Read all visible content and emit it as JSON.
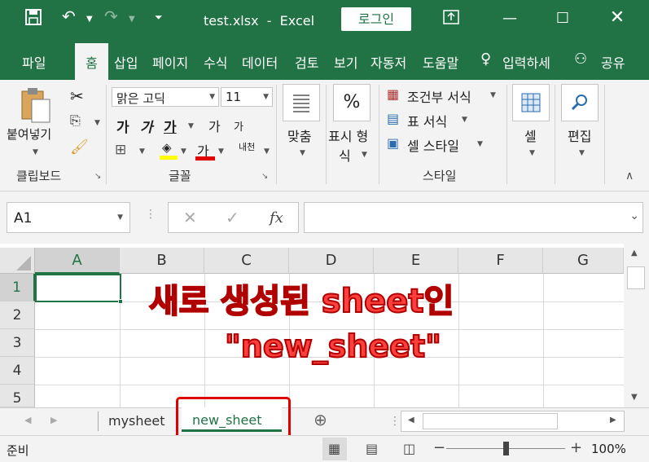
{
  "titlebar": {
    "title": "test.xlsx  -  Excel",
    "login_label": "로그인"
  },
  "tabs": [
    "파일",
    "홈",
    "삽입",
    "페이지",
    "수식",
    "데이터",
    "검토",
    "보기",
    "자동저",
    "도움말"
  ],
  "tell_me": "입력하세",
  "share": "공유",
  "ribbon": {
    "clipboard": {
      "paste_label": "붙여넣기",
      "group_label": "클립보드"
    },
    "font": {
      "font_name": "맑은 고딕",
      "font_size": "11",
      "bold": "가",
      "italic": "가",
      "underline": "가",
      "grow": "가",
      "shrink": "가",
      "font_color_glyph": "가",
      "phonetic": "내천",
      "group_label": "글꼴"
    },
    "alignment": {
      "label": "맞춤"
    },
    "number": {
      "label_line1": "표시 형",
      "label_line2": "식",
      "glyph": "%"
    },
    "styles": {
      "conditional": "조건부 서식",
      "table": "표 서식",
      "cell_style": "셀 스타일",
      "group_label": "스타일"
    },
    "cells": {
      "label": "셀"
    },
    "editing": {
      "label": "편집"
    }
  },
  "formula_bar": {
    "name_box": "A1",
    "fx": "fx",
    "formula": ""
  },
  "grid": {
    "columns": [
      "A",
      "B",
      "C",
      "D",
      "E",
      "F",
      "G"
    ],
    "rows": [
      "1",
      "2",
      "3",
      "4",
      "5"
    ]
  },
  "annotation": {
    "line1": "새로 생성된 sheet인",
    "line2": "\"new_sheet\"",
    "color": "#e53935"
  },
  "sheets": {
    "tabs": [
      "mysheet",
      "new_sheet"
    ],
    "active": "new_sheet"
  },
  "status": {
    "ready": "준비",
    "zoom": "100%",
    "zoom_minus": "−",
    "zoom_plus": "+"
  },
  "colors": {
    "excel_green": "#217346",
    "ribbon_bg": "#f3f3f3",
    "highlight_red": "#e00000"
  }
}
